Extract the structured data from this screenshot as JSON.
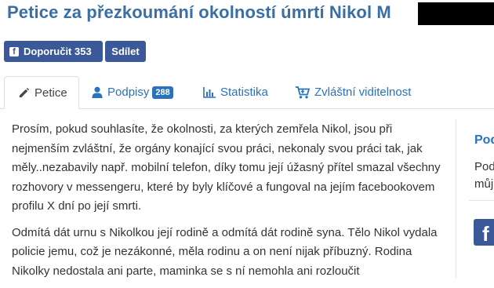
{
  "header": {
    "title": "Petice za přezkoumání okolností úmrtí Nikol M"
  },
  "social": {
    "recommend_label": "Doporučit 353",
    "share_label": "Sdílet"
  },
  "tabs": [
    {
      "label": "Petice",
      "icon": "pencil-icon",
      "active": true
    },
    {
      "label": "Podpisy",
      "icon": "user-icon",
      "badge": "288"
    },
    {
      "label": "Statistika",
      "icon": "bar-chart-icon"
    },
    {
      "label": "Zvláštní viditelnost",
      "icon": "cart-icon"
    }
  ],
  "content": {
    "paragraphs": [
      "Prosím, pokud souhlasíte, že okolnosti, za kterých zemřela Nikol, jsou při nejmenším zvláštní, že orgány konající svou práci, nekonaly svou práci tak, jak měly..nezabavily např. mobilní telefon, díky tomu její úžasný přítel smazal všechny rozhovory v messengeru, které by byly klíčové a fungoval na jejím facebookovem profilu X dní po její smrti.",
      "Odmítá dát urnu s Nikolkou její rodině a odmítá dát rodině syna. Tělo Nikol vydala policie jemu, což je nezákonné, měla rodinu a on není nijak příbuzný. Rodina Nikolky nedostala ani parte, maminka se s ní nemohla ani rozloučit"
    ]
  },
  "sidebar": {
    "heading": "Pod",
    "text_line1": "Pod",
    "text_line2": "můj",
    "fb_glyph": "f"
  },
  "colors": {
    "title": "#3a6ea5",
    "facebook": "#3b5998",
    "link": "#2a72b9"
  }
}
